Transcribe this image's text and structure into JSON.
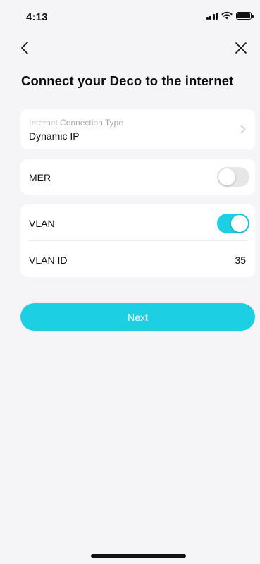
{
  "status_bar": {
    "time": "4:13",
    "icons": [
      "signal-icon",
      "wifi-icon",
      "battery-icon"
    ]
  },
  "nav": {
    "back_icon": "chevron-left-icon",
    "close_icon": "close-icon"
  },
  "page": {
    "title": "Connect your Deco to the internet"
  },
  "connection_type": {
    "label": "Internet Connection Type",
    "value": "Dynamic IP"
  },
  "mer": {
    "label": "MER",
    "enabled": false
  },
  "vlan": {
    "label": "VLAN",
    "enabled": true,
    "id_label": "VLAN ID",
    "id_value": "35"
  },
  "actions": {
    "next_label": "Next"
  },
  "colors": {
    "accent": "#1ccfe2",
    "background": "#f5f5f7",
    "card": "#ffffff",
    "toggle_off": "#e7e7ea",
    "secondary_text": "#a9a9ae"
  }
}
